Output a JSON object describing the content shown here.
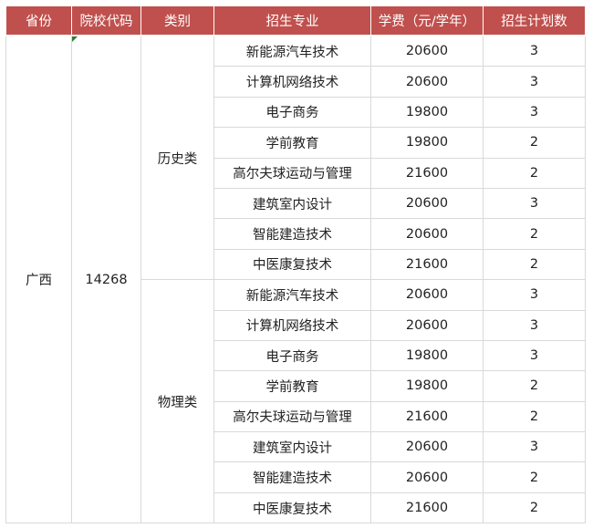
{
  "headers": [
    "省份",
    "院校代码",
    "类别",
    "招生专业",
    "学费（元/学年）",
    "招生计划数"
  ],
  "province": "广西",
  "school_code": "14268",
  "groups": [
    {
      "category": "历史类",
      "rows": [
        {
          "major": "新能源汽车技术",
          "fee": "20600",
          "plan": "3"
        },
        {
          "major": "计算机网络技术",
          "fee": "20600",
          "plan": "3"
        },
        {
          "major": "电子商务",
          "fee": "19800",
          "plan": "3"
        },
        {
          "major": "学前教育",
          "fee": "19800",
          "plan": "2"
        },
        {
          "major": "高尔夫球运动与管理",
          "fee": "21600",
          "plan": "2"
        },
        {
          "major": "建筑室内设计",
          "fee": "20600",
          "plan": "3"
        },
        {
          "major": "智能建造技术",
          "fee": "20600",
          "plan": "2"
        },
        {
          "major": "中医康复技术",
          "fee": "21600",
          "plan": "2"
        }
      ]
    },
    {
      "category": "物理类",
      "rows": [
        {
          "major": "新能源汽车技术",
          "fee": "20600",
          "plan": "3"
        },
        {
          "major": "计算机网络技术",
          "fee": "20600",
          "plan": "3"
        },
        {
          "major": "电子商务",
          "fee": "19800",
          "plan": "3"
        },
        {
          "major": "学前教育",
          "fee": "19800",
          "plan": "2"
        },
        {
          "major": "高尔夫球运动与管理",
          "fee": "21600",
          "plan": "2"
        },
        {
          "major": "建筑室内设计",
          "fee": "20600",
          "plan": "3"
        },
        {
          "major": "智能建造技术",
          "fee": "20600",
          "plan": "2"
        },
        {
          "major": "中医康复技术",
          "fee": "21600",
          "plan": "2"
        }
      ]
    }
  ]
}
